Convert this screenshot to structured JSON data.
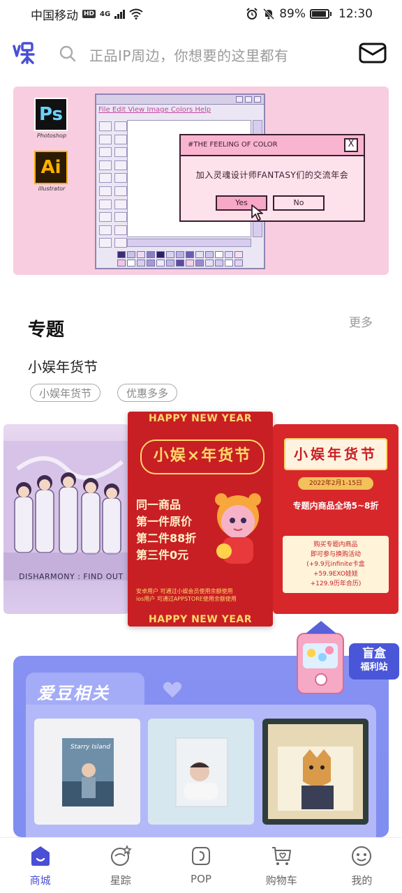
{
  "status_bar": {
    "carrier": "中国移动",
    "hd": "HD",
    "network": "4G",
    "battery": "89%",
    "time": "12:30",
    "battery_level": 0.89
  },
  "header": {
    "logo_icon": "yule-logo-icon",
    "search_placeholder": "正品IP周边，你想要的这里都有"
  },
  "banner": {
    "ps_label": "Ps",
    "ps_caption": "Photoshop",
    "ai_label": "Ai",
    "ai_caption": "illustrator",
    "paint_menu": "File Edit View Image Colors Help",
    "dialog_title": "#THE FEELING OF COLOR",
    "dialog_close": "X",
    "dialog_message": "加入灵魂设计师FANTASY们的交流年会",
    "dialog_yes": "Yes",
    "dialog_no": "No"
  },
  "topic": {
    "section_title": "专题",
    "more": "更多",
    "name": "小娱年货节",
    "tags": [
      "小娱年货节",
      "优惠多多"
    ]
  },
  "carousel": {
    "left_caption": "DISHARMONY : FIND OUT",
    "mid_header": "HAPPY NEW YEAR",
    "mid_tag": "小娱×年货节",
    "mid_lines": [
      "同一商品",
      "第一件原价",
      "第二件88折",
      "第三件0元"
    ],
    "mid_footer_lines": [
      "安卓用户 可通过小娱会员使用余额使用",
      "ios用户 可通过APPSTORE使用余额使用"
    ],
    "mid_bottom": "HAPPY NEW YEAR",
    "right_title": "小娱年货节",
    "right_date": "2022年2月1-15日",
    "right_promo": "专题内商品全场5~8折",
    "right_box_lines": [
      "购买专题内商品",
      "即可参与换购活动",
      "(+9.9元infinite卡盒",
      "+59.9EXO娃娃",
      "+129.9历年合历)"
    ]
  },
  "idol": {
    "title": "爱豆相关",
    "blind_box_line1": "盲盒",
    "blind_box_line2": "福利站",
    "products": [
      {
        "label": "Starry Island"
      },
      {
        "label": ""
      },
      {
        "label": ""
      }
    ]
  },
  "bottom_nav": [
    {
      "label": "商城",
      "icon": "home-icon",
      "active": true
    },
    {
      "label": "星踪",
      "icon": "star-planet-icon",
      "active": false
    },
    {
      "label": "POP",
      "icon": "pop-icon",
      "active": false
    },
    {
      "label": "购物车",
      "icon": "cart-icon",
      "active": false
    },
    {
      "label": "我的",
      "icon": "profile-icon",
      "active": false
    }
  ],
  "colors": {
    "accent": "#4a4fd6",
    "banner_bg": "#f8cde0",
    "festival_red": "#c81f24",
    "idol_panel": "#8791f2"
  }
}
